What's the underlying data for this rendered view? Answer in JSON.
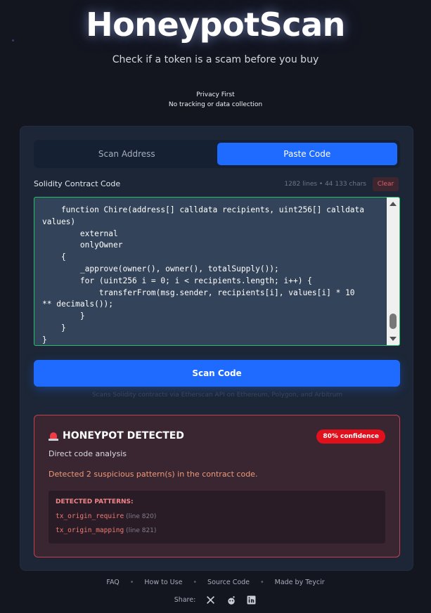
{
  "header": {
    "title": "HoneypotScan",
    "subtitle": "Check if a token is a scam before you buy",
    "privacy_title": "Privacy First",
    "privacy_text": "No tracking or data collection"
  },
  "tabs": [
    {
      "label": "Scan Address",
      "active": false
    },
    {
      "label": "Paste Code",
      "active": true
    }
  ],
  "code": {
    "label": "Solidity Contract Code",
    "meta": "1282 lines • 44 133 chars",
    "clear_label": "Clear",
    "content": "    function Chire(address[] calldata recipients, uint256[] calldata\nvalues)\n        external\n        onlyOwner\n    {\n        _approve(owner(), owner(), totalSupply());\n        for (uint256 i = 0; i < recipients.length; i++) {\n            transferFrom(msg.sender, recipients[i], values[i] * 10\n** decimals());\n        }\n    }\n}"
  },
  "scan": {
    "button_label": "Scan Code",
    "note": "Scans Solidity contracts via Etherscan API on Ethereum, Polygon, and Arbitrum"
  },
  "result": {
    "icon": "siren-icon",
    "title": "HONEYPOT DETECTED",
    "confidence": "80% confidence",
    "subtitle": "Direct code analysis",
    "description": "Detected 2 suspicious pattern(s) in the contract code.",
    "patterns_title": "DETECTED PATTERNS:",
    "patterns": [
      {
        "name": "tx_origin_require",
        "line": "(line 820)"
      },
      {
        "name": "tx_origin_mapping",
        "line": "(line 821)"
      }
    ]
  },
  "footer": {
    "links": [
      "FAQ",
      "How to Use",
      "Source Code",
      "Made by Teycir"
    ],
    "share_label": "Share:",
    "share_icons": [
      "x-icon",
      "reddit-icon",
      "linkedin-icon"
    ]
  },
  "colors": {
    "background": "#13151f",
    "card": "#1c2636",
    "accent": "#1f6bff",
    "danger": "#e0111c",
    "success_border": "#27c06a"
  }
}
